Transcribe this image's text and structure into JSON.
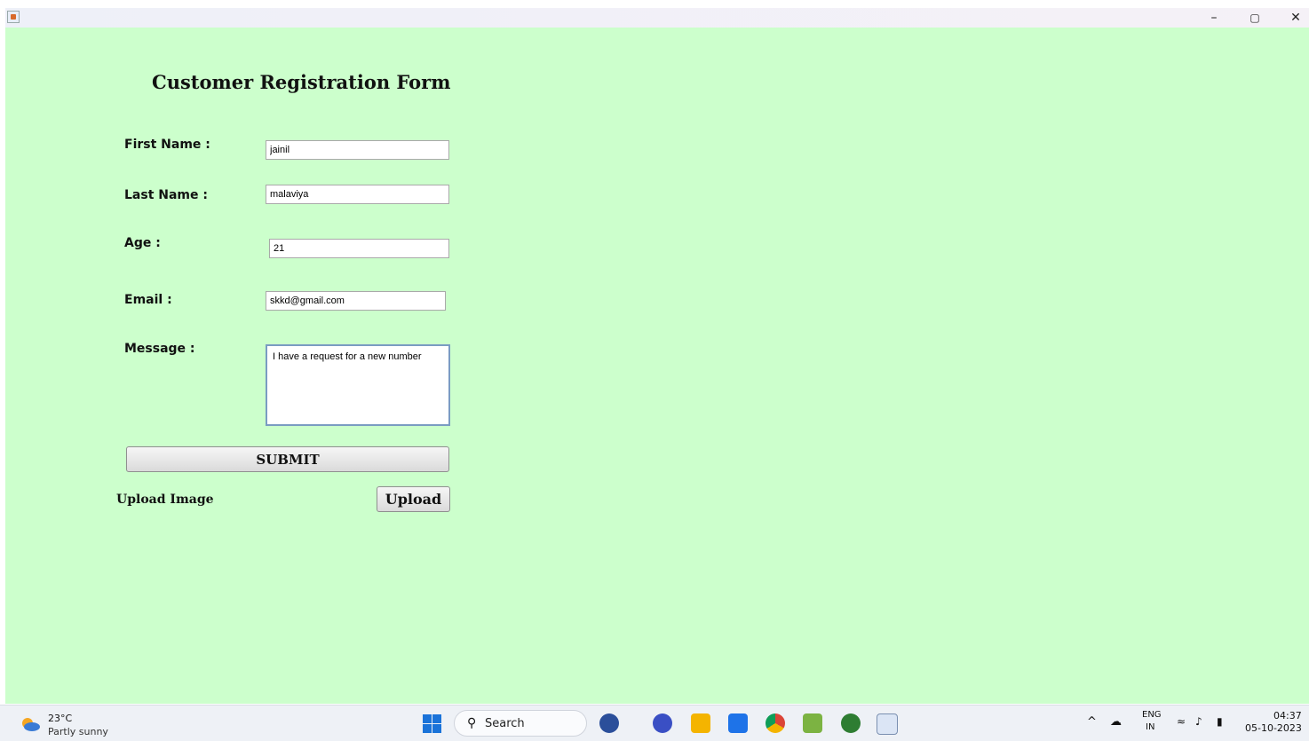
{
  "window": {
    "controls": {
      "minimize": "–",
      "maximize": "▢",
      "close": "✕"
    }
  },
  "form": {
    "title": "Customer Registration Form",
    "first_name_label": "First Name :",
    "first_name_value": "jainil",
    "last_name_label": "Last Name :",
    "last_name_value": "malaviya",
    "age_label": "Age :",
    "age_value": "21",
    "email_label": "Email :",
    "email_value": "skkd@gmail.com",
    "message_label": "Message :",
    "message_value": "I have a request for a new number",
    "submit_label": "SUBMIT",
    "upload_image_label": "Upload Image",
    "upload_button_label": "Upload",
    "background_color": "#ccffcc"
  },
  "taskbar": {
    "weather_temp": "23°C",
    "weather_desc": "Partly sunny",
    "search_label": "Search",
    "language_top": "ENG",
    "language_bottom": "IN",
    "time": "04:37",
    "date": "05-10-2023",
    "apps": [
      "cricket-app-icon",
      "meet-icon",
      "file-explorer-icon",
      "l-app-icon",
      "chrome-icon",
      "paint-icon",
      "cube-app-icon",
      "java-app-icon"
    ]
  }
}
